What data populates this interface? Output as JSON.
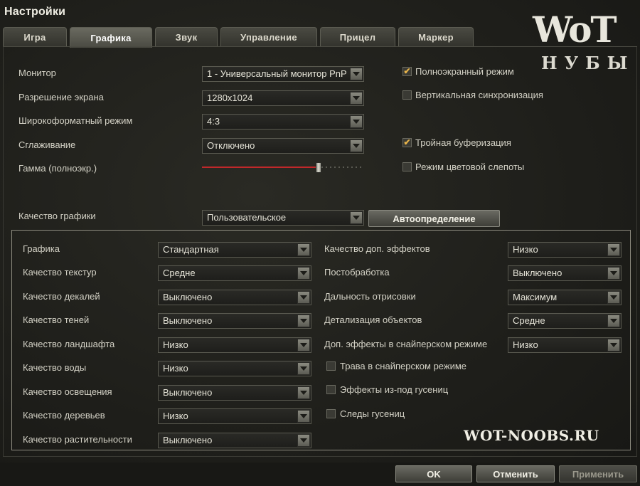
{
  "window": {
    "title": "Настройки"
  },
  "tabs": [
    {
      "label": "Игра",
      "active": false
    },
    {
      "label": "Графика",
      "active": true
    },
    {
      "label": "Звук",
      "active": false
    },
    {
      "label": "Управление",
      "active": false
    },
    {
      "label": "Прицел",
      "active": false
    },
    {
      "label": "Маркер",
      "active": false
    }
  ],
  "display": {
    "monitor_label": "Монитор",
    "monitor_value": "1 - Универсальный монитор PnP",
    "resolution_label": "Разрешение экрана",
    "resolution_value": "1280x1024",
    "widescreen_label": "Широкоформатный режим",
    "widescreen_value": "4:3",
    "aa_label": "Сглаживание",
    "aa_value": "Отключено",
    "gamma_label": "Гамма (полноэкр.)",
    "gamma_level_fraction": 0.72
  },
  "checks_top": {
    "fullscreen": {
      "label": "Полноэкранный режим",
      "checked": true
    },
    "vsync": {
      "label": "Вертикальная синхронизация",
      "checked": false
    },
    "triple_buffer": {
      "label": "Тройная буферизация",
      "checked": true
    },
    "colorblind": {
      "label": "Режим цветовой слепоты",
      "checked": false
    }
  },
  "quality": {
    "label": "Качество графики",
    "value": "Пользовательское",
    "autodetect_label": "Автоопределение"
  },
  "left_settings": [
    {
      "label": "Графика",
      "value": "Стандартная"
    },
    {
      "label": "Качество текстур",
      "value": "Средне"
    },
    {
      "label": "Качество декалей",
      "value": "Выключено"
    },
    {
      "label": "Качество теней",
      "value": "Выключено"
    },
    {
      "label": "Качество ландшафта",
      "value": "Низко"
    },
    {
      "label": "Качество воды",
      "value": "Низко"
    },
    {
      "label": "Качество освещения",
      "value": "Выключено"
    },
    {
      "label": "Качество деревьев",
      "value": "Низко"
    },
    {
      "label": "Качество растительности",
      "value": "Выключено"
    }
  ],
  "right_settings": [
    {
      "label": "Качество доп. эффектов",
      "value": "Низко"
    },
    {
      "label": "Постобработка",
      "value": "Выключено"
    },
    {
      "label": "Дальность отрисовки",
      "value": "Максимум"
    },
    {
      "label": "Детализация объектов",
      "value": "Средне"
    },
    {
      "label": "Доп. эффекты в снайперском режиме",
      "value": "Низко"
    }
  ],
  "right_checks": [
    {
      "label": "Трава в снайперском режиме",
      "checked": false
    },
    {
      "label": "Эффекты из-под гусениц",
      "checked": false
    },
    {
      "label": "Следы гусениц",
      "checked": false
    }
  ],
  "buttons": {
    "ok": "OK",
    "cancel": "Отменить",
    "apply": "Применить"
  },
  "branding": {
    "logo_top": "WoT",
    "logo_bottom": "НУБЫ",
    "watermark": "WOT-NOOBS.RU"
  },
  "colors": {
    "accent_check": "#e8b44a",
    "slider_fill": "#c0282a"
  }
}
